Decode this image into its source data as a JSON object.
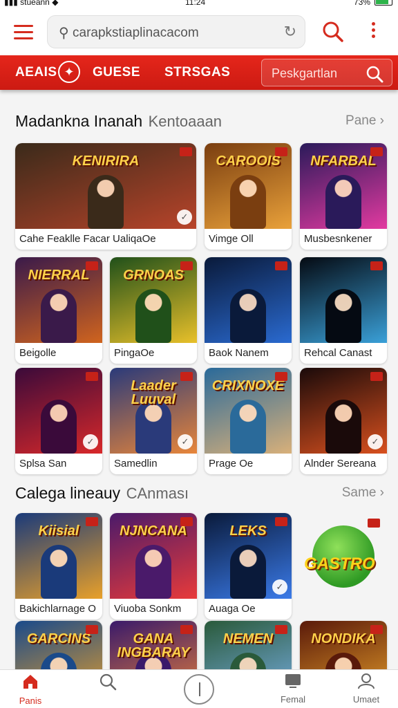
{
  "status_bar": {
    "carrier": "stueann",
    "time": "11:24",
    "battery": "73%",
    "battery_level": 0.73
  },
  "toolbar": {
    "url": "carapkstiaplinacacom"
  },
  "nav": {
    "tabs": [
      "AEAIS",
      "GUESE",
      "STRSGAS"
    ],
    "search_placeholder": "Peskgartlan"
  },
  "sections": [
    {
      "title": "Madankna Inanah",
      "subtitle": "Kentoaaan",
      "more": "Pane",
      "rows": [
        [
          {
            "label": "Cahe Feaklle Facar UaliqaOe",
            "art_title": "KENIRIRA",
            "wide": true,
            "colors": [
              "#3a2a1a",
              "#b8442a"
            ],
            "check": true
          },
          {
            "label": "Vimge Oll",
            "art_title": "CAROOIS",
            "colors": [
              "#7a3e10",
              "#e9a13a"
            ],
            "check": false
          },
          {
            "label": "Musbesnkener",
            "art_title": "NFARBAL",
            "colors": [
              "#2a1a5a",
              "#e23aa0"
            ],
            "check": false
          }
        ],
        [
          {
            "label": "Beigolle",
            "art_title": "NIERRAL",
            "colors": [
              "#3a1a4a",
              "#d0641e"
            ],
            "check": false
          },
          {
            "label": "PingaOe",
            "art_title": "GRNOAS",
            "colors": [
              "#20501a",
              "#e8c02a"
            ],
            "check": false
          },
          {
            "label": "Baok Nanem",
            "art_title": "",
            "colors": [
              "#0a1a3a",
              "#2a6ad0"
            ],
            "check": false
          },
          {
            "label": "Rehcal Canast",
            "art_title": "",
            "colors": [
              "#050a12",
              "#3aa0d8"
            ],
            "check": false
          }
        ],
        [
          {
            "label": "Splsa San",
            "art_title": "",
            "colors": [
              "#3a0a3a",
              "#d8282a"
            ],
            "check": true
          },
          {
            "label": "Samedlin",
            "art_title": "Laader Luuval",
            "colors": [
              "#2a3a7a",
              "#e8863a"
            ],
            "check": true
          },
          {
            "label": "Prage Oe",
            "art_title": "CRIXNOXE",
            "colors": [
              "#2a6a9a",
              "#d8b07a"
            ],
            "check": false
          },
          {
            "label": "Alnder Sereana",
            "art_title": "",
            "colors": [
              "#1a0a0a",
              "#d8501e"
            ],
            "check": true
          }
        ]
      ]
    },
    {
      "title": "Calega lineauy",
      "subtitle": "CAnması",
      "more": "Same",
      "rows": [
        [
          {
            "label": "Bakichlarnage O",
            "art_title": "Kiisial",
            "colors": [
              "#1a3a7a",
              "#e8a02a"
            ],
            "check": false
          },
          {
            "label": "Viuoba Sonkm",
            "art_title": "NJNCANA",
            "colors": [
              "#4a1a6a",
              "#e83a3a"
            ],
            "check": false
          },
          {
            "label": "Auaga Oe",
            "art_title": "LEKS",
            "colors": [
              "#0a1a3a",
              "#3a7ae8"
            ],
            "check": true
          }
        ],
        [
          {
            "label": "",
            "art_title": "GARCINS",
            "colors": [
              "#1a4a8a",
              "#e8a02a"
            ],
            "check": false
          },
          {
            "label": "",
            "art_title": "GANA INGBARAY",
            "colors": [
              "#3a1a6a",
              "#e8803a"
            ],
            "check": false
          },
          {
            "label": "",
            "art_title": "NEMEN",
            "colors": [
              "#2a5a3a",
              "#7ab0e8"
            ],
            "check": false
          },
          {
            "label": "",
            "art_title": "NONDIKA",
            "colors": [
              "#5a1a0a",
              "#e8a02a"
            ],
            "check": false
          }
        ]
      ],
      "featured": {
        "word": "GASTRO"
      }
    }
  ],
  "bottom_nav": [
    {
      "label": "Panis",
      "icon": "home-icon",
      "active": true
    },
    {
      "label": "",
      "icon": "search-icon",
      "active": false
    },
    {
      "label": "",
      "icon": "power-icon",
      "active": false
    },
    {
      "label": "Femal",
      "icon": "tv-icon",
      "active": false
    },
    {
      "label": "Umaet",
      "icon": "user-icon",
      "active": false
    }
  ],
  "theme": {
    "accent": "#d52b1e"
  }
}
